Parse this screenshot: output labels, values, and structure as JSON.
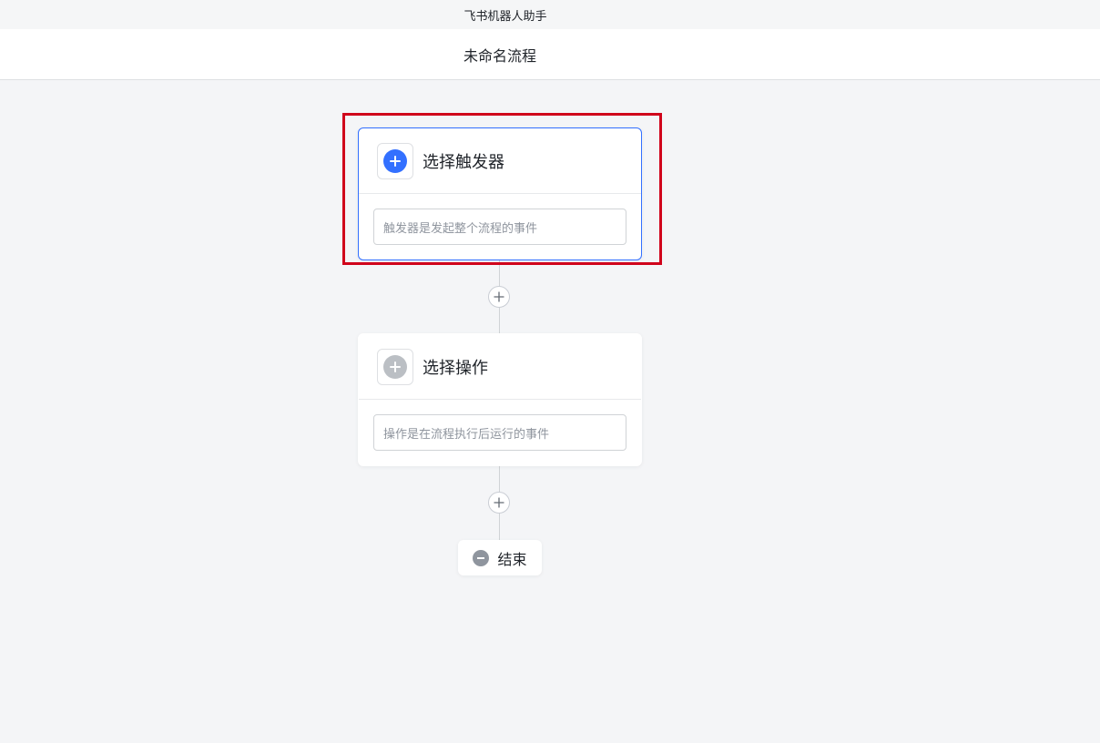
{
  "window": {
    "title": "飞书机器人助手"
  },
  "header": {
    "flow_name": "未命名流程"
  },
  "trigger_node": {
    "title": "选择触发器",
    "description": "触发器是发起整个流程的事件",
    "icon": "plus-circle-icon",
    "accent_color": "#3370ff"
  },
  "action_node": {
    "title": "选择操作",
    "description": "操作是在流程执行后运行的事件",
    "icon": "plus-circle-icon",
    "icon_color": "#bbbfc4"
  },
  "add_step_icon": "plus-icon",
  "end_node": {
    "label": "结束",
    "icon": "minus-circle-icon"
  },
  "highlight": {
    "color": "#d0021b"
  }
}
